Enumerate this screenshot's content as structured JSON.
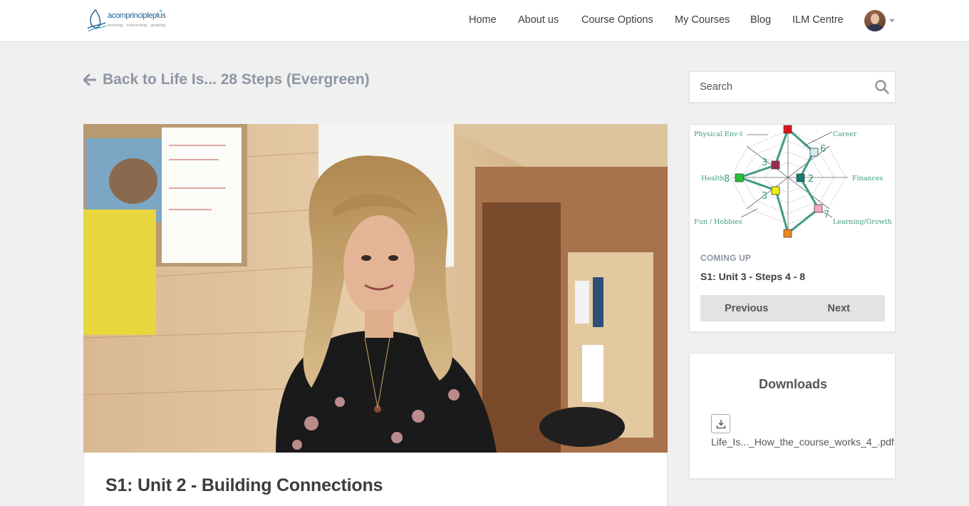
{
  "header": {
    "logo_text": "acornprincipleplus",
    "logo_plus": "+",
    "logo_tagline": "learning · connecting · growing",
    "nav": [
      {
        "label": "Home"
      },
      {
        "label": "About us"
      },
      {
        "label": "Course Options"
      },
      {
        "label": "My Courses"
      },
      {
        "label": "Blog"
      },
      {
        "label": "ILM Centre"
      }
    ]
  },
  "back_link": {
    "label": "Back to Life Is... 28 Steps (Evergreen)"
  },
  "lesson": {
    "title": "S1: Unit 2 - Building Connections"
  },
  "search": {
    "placeholder": "Search"
  },
  "wheel": {
    "labels": {
      "physical": "Physical Env-t",
      "career": "Career",
      "health": "Health",
      "finances": "Finances",
      "fun": "Fun / Hobbies",
      "learning": "Learning/Growth"
    },
    "scores": {
      "physical": "3",
      "career": "6",
      "health": "8",
      "finances": "2",
      "fun": "3",
      "learning": "7"
    },
    "colors": {
      "line": "#3f9b83",
      "top": "#e0101a",
      "career": "#cdeef3",
      "physical": "#9a2a55",
      "finances": "#157a73",
      "health": "#22c13a",
      "fun": "#f2ee14",
      "learning": "#f2a7c8",
      "bottom": "#f0861a"
    }
  },
  "coming_up": {
    "label": "COMING UP",
    "title": "S1: Unit 3 - Steps 4 - 8",
    "previous": "Previous",
    "next": "Next"
  },
  "downloads": {
    "title": "Downloads",
    "file": "Life_Is..._How_the_course_works_4_.pdf"
  }
}
